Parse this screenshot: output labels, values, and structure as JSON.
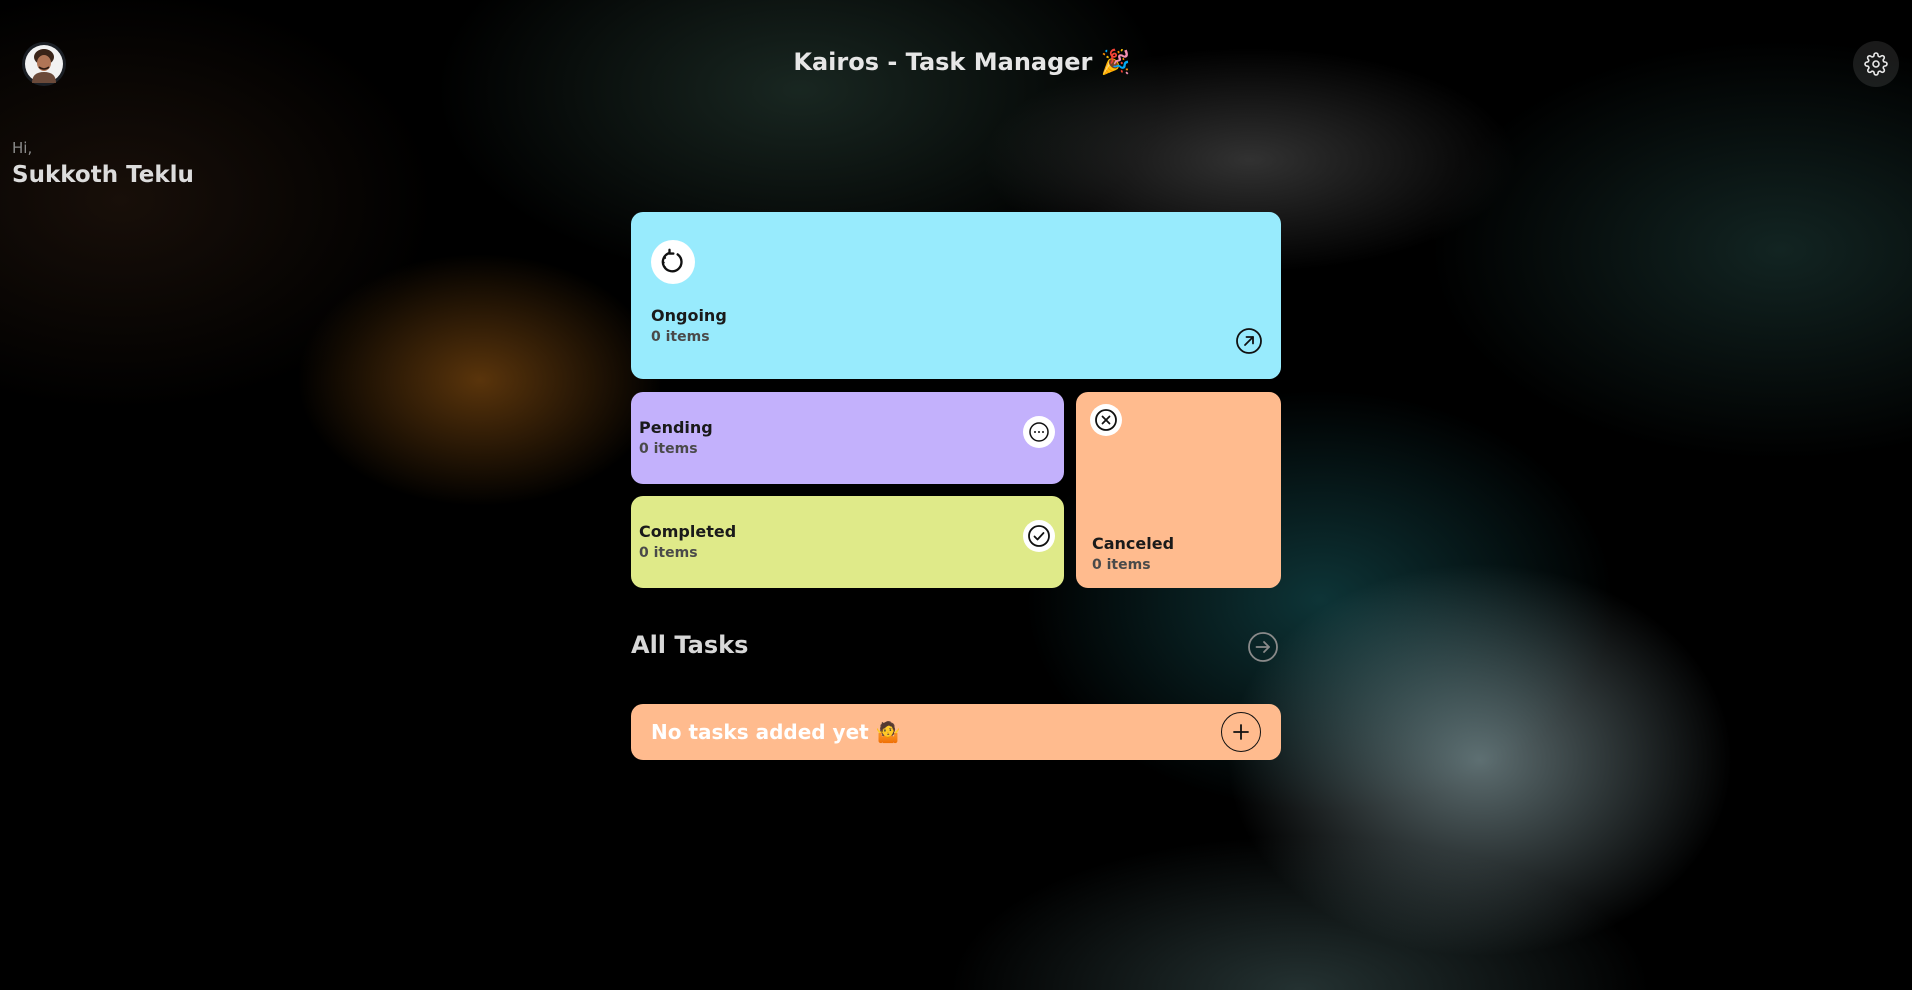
{
  "header": {
    "title": "Kairos - Task Manager 🎉",
    "avatar_icon": "user-avatar",
    "settings_icon": "gear-icon"
  },
  "greeting": {
    "hi": "Hi,",
    "name": "Sukkoth Teklu"
  },
  "cards": {
    "ongoing": {
      "label": "Ongoing",
      "count": "0 items",
      "icon": "rotate-icon",
      "action_icon": "arrow-up-right-icon",
      "color": "#98ebfd"
    },
    "pending": {
      "label": "Pending",
      "count": "0 items",
      "icon": "ellipsis-icon",
      "color": "#c3b1fc"
    },
    "completed": {
      "label": "Completed",
      "count": "0 items",
      "icon": "check-icon",
      "color": "#dfea89"
    },
    "canceled": {
      "label": "Canceled",
      "count": "0 items",
      "icon": "x-icon",
      "color": "#ffbb8e"
    }
  },
  "all_tasks": {
    "title": "All Tasks",
    "action_icon": "arrow-right-icon",
    "empty_text": "No tasks added yet 🤷",
    "add_icon": "plus-icon"
  }
}
